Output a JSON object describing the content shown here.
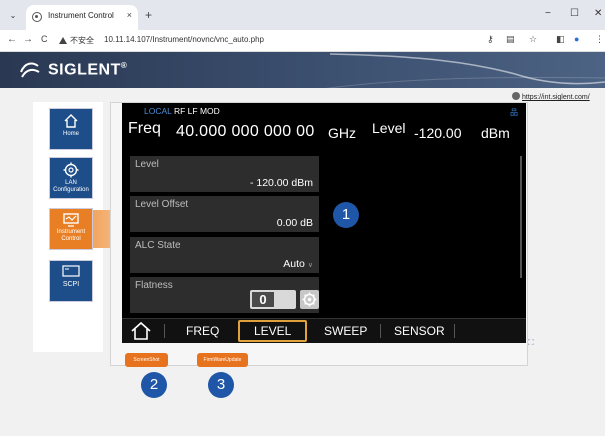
{
  "browser": {
    "tab_title": "Instrument Control",
    "tab_close": "×",
    "new_tab": "+",
    "window": {
      "minimize": "−",
      "maximize": "☐",
      "close": "✕"
    },
    "back": "←",
    "forward": "→",
    "reload": "C",
    "security_label": "不安全",
    "url": "10.11.14.107/Instrument/novnc/vnc_auto.php"
  },
  "header": {
    "brand": "SIGLENT",
    "registered": "®"
  },
  "sidebar": {
    "items": [
      {
        "label": "Home",
        "icon": "home-icon",
        "active": false
      },
      {
        "label": "LAN Configuration",
        "icon": "gear-icon",
        "active": false
      },
      {
        "label": "Instrument Control",
        "icon": "monitor-icon",
        "active": true
      },
      {
        "label": "SCPI",
        "icon": "terminal-icon",
        "active": false
      }
    ]
  },
  "external_link": "https://int.siglent.com/",
  "instrument": {
    "status": {
      "local": "LOCAL",
      "rf": "RF",
      "lf": "LF",
      "mod": "MOD"
    },
    "freq_label": "Freq",
    "freq_value": "40.000 000 000 00",
    "freq_unit": "GHz",
    "level_label": "Level",
    "level_value": "-120.00",
    "level_unit": "dBm",
    "softkeys": [
      {
        "title": "Level",
        "value": "- 120.00 dBm"
      },
      {
        "title": "Level Offset",
        "value": "0.00 dB"
      },
      {
        "title": "ALC State",
        "value": "Auto"
      },
      {
        "title": "Flatness",
        "toggle": "0"
      }
    ],
    "menu": [
      "FREQ",
      "LEVEL",
      "SWEEP",
      "SENSOR"
    ],
    "active_menu": "LEVEL"
  },
  "buttons": {
    "screenshot": "ScreenShot",
    "firmware": "FirmWareUpdate"
  },
  "callouts": [
    "1",
    "2",
    "3"
  ],
  "colors": {
    "accent_orange": "#e8731f",
    "sidebar_blue": "#1e4e8a",
    "callout_blue": "#1f56a8",
    "menu_highlight": "#e0a23a"
  }
}
